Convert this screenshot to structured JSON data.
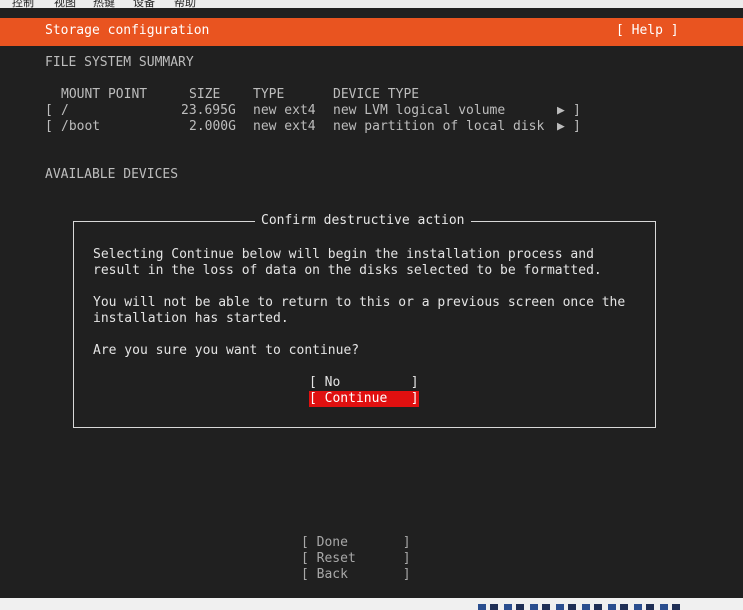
{
  "menubar": {
    "items": [
      "控制",
      "视图",
      "热键",
      "设备",
      "帮助"
    ]
  },
  "header": {
    "title": "Storage configuration",
    "help_label": "[ Help ]"
  },
  "summary": {
    "heading": "FILE SYSTEM SUMMARY",
    "columns": [
      "MOUNT POINT",
      "SIZE",
      "TYPE",
      "DEVICE TYPE"
    ],
    "rows": [
      {
        "open": "[",
        "mount": "/",
        "size": "23.695G",
        "type": "new ext4",
        "device_type": "new LVM logical volume",
        "arrow": "▶",
        "close": "]"
      },
      {
        "open": "[",
        "mount": "/boot",
        "size": "2.000G",
        "type": "new ext4",
        "device_type": "new partition of local disk",
        "arrow": "▶",
        "close": "]"
      }
    ]
  },
  "available": {
    "heading": "AVAILABLE DEVICES"
  },
  "dialog": {
    "title": "Confirm destructive action",
    "lines": [
      "Selecting Continue below will begin the installation process and",
      "result in the loss of data on the disks selected to be formatted.",
      "You will not be able to return to this or a previous screen once the",
      "installation has started.",
      "Are you sure you want to continue?"
    ],
    "buttons": {
      "no": "[ No         ]",
      "continue": "[ Continue   ]"
    }
  },
  "footer_buttons": {
    "done": "[ Done       ]",
    "reset": "[ Reset      ]",
    "back": "[ Back       ]"
  },
  "colors": {
    "accent": "#e95420",
    "focus": "#e01010",
    "background": "#202020"
  }
}
